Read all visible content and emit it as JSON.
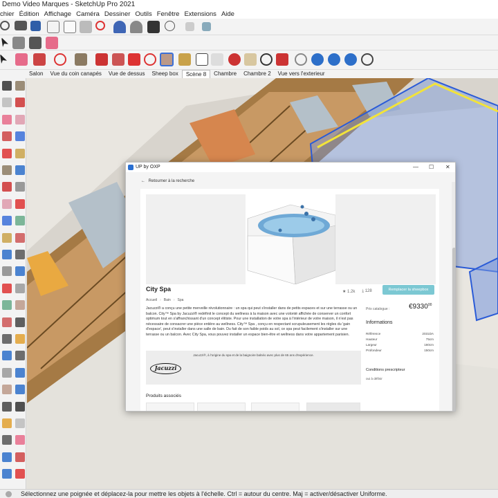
{
  "app": {
    "title": "Demo Video Marques - SketchUp Pro 2021"
  },
  "menu": [
    "chier",
    "Édition",
    "Affichage",
    "Caméra",
    "Dessiner",
    "Outils",
    "Fenêtre",
    "Extensions",
    "Aide"
  ],
  "scenes": [
    "Salon",
    "Vue du coin canapés",
    "Vue de dessus",
    "Sheep box",
    "Scène 8",
    "Chambre",
    "Chambre 2",
    "Vue vers l'exterieur"
  ],
  "active_scene": "Scène 8",
  "status": "Sélectionnez une poignée et déplacez-la pour mettre les objets à l'échelle. Ctrl = autour du centre. Maj = activer/désactiver Uniforme.",
  "dialog": {
    "title": "UP by OXP",
    "controls": {
      "minimize": "—",
      "maximize": "☐",
      "close": "✕"
    },
    "back_label": "Retourner à la recherche",
    "product": {
      "name": "City Spa",
      "breadcrumb": [
        "Accueil",
        "Bain",
        "Spa"
      ],
      "likes": "1.2k",
      "downloads": "128",
      "replace_label": "Remplacer la sheepbox",
      "description": "Jacuzzi® a conçu une petite merveille révolutionnaire : un spa qui peut s'installer dans de petits espaces et sur une terrasse ou un balcon. City™ Spa by Jacuzzi® redéfinit le concept du wellness à la maison avec une volonté affichée de conserver un confort optimum tout en s'affranchissant d'un concept élitiste. Pour une installation de votre spa à l'intérieur de votre maison, il n'est pas nécessaire de consacrer une pièce entière au wellness. City™ Spa , conçu en respectant scrupuleusement les règles du 'gain d'espace', peut s'installer dans une salle de bain. Du fait de son faible poids au sol, ce spa peut facilement s'installer sur une terrasse ou un balcon. Avec City Spa, vous pouvez installer un espace bien-être et wellness dans votre appartement parisien.",
      "brand_text": "Jacuzzi®, à l'origine du spa et de la baignoire balnéo avec plus de 65 ans d'expérience.",
      "brand_logo": "Jacuzzi",
      "price_label": "Prix catalogue :",
      "price_main": "€9330",
      "price_cents": "00",
      "info_title": "Informations",
      "info": [
        {
          "k": "Référence",
          "v": "2031DA"
        },
        {
          "k": "Hauteur",
          "v": "75cm"
        },
        {
          "k": "Largeur",
          "v": "160cm"
        },
        {
          "k": "Profondeur",
          "v": "150cm"
        }
      ],
      "conditions_title": "Conditions prescripteur",
      "conditions_value": "oui à définir",
      "related_title": "Produits associés"
    }
  },
  "colors": {
    "accent_button": "#7cc8d3",
    "selection_box": "#2a5bd7",
    "selection_yellow": "#f2e33a"
  }
}
